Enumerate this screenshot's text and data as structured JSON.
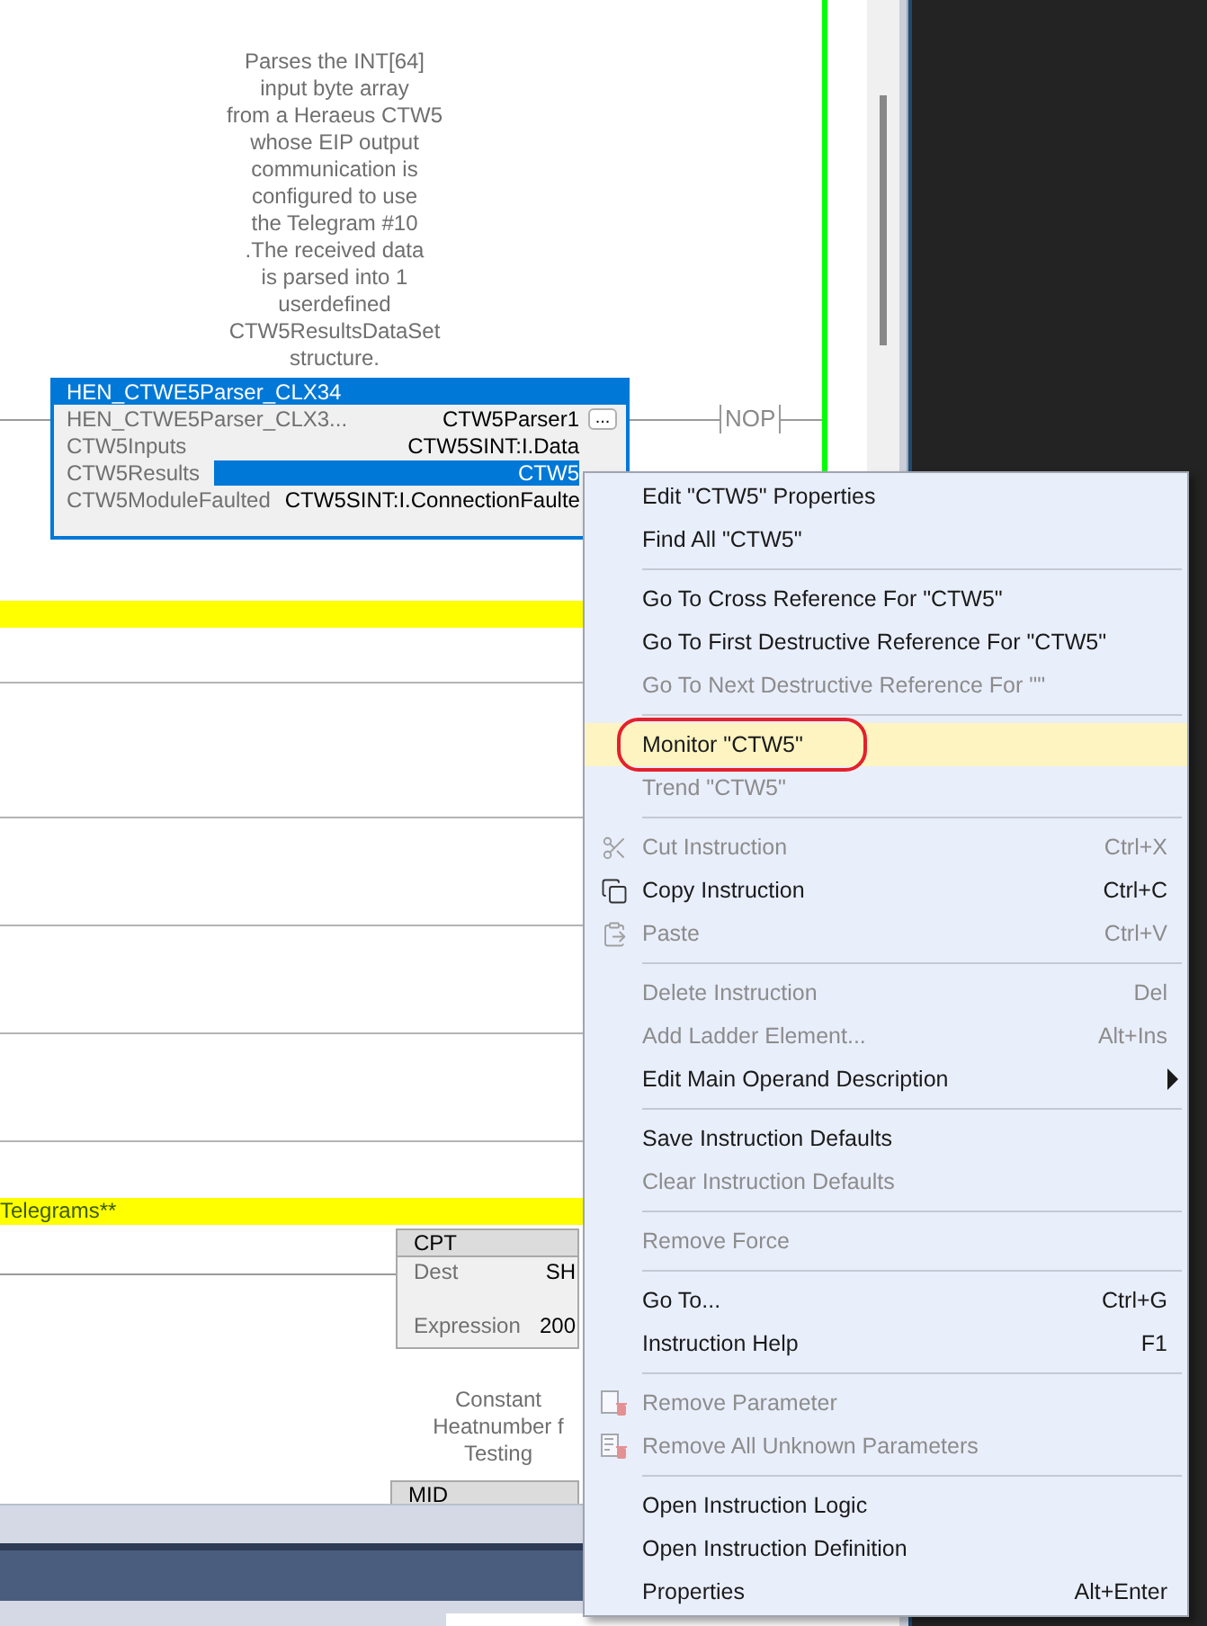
{
  "rung_description": {
    "lines": [
      "Parses the INT[64]",
      "input byte array",
      "from a Heraeus CTW5",
      "whose EIP output",
      "communication is",
      "configured to use",
      "the Telegram #10",
      ".The received data",
      "is parsed into 1",
      "userdefined",
      "CTW5ResultsDataSet",
      "structure."
    ]
  },
  "instruction_block": {
    "name": "HEN_CTWE5Parser_CLX34",
    "parameters": [
      {
        "name": "HEN_CTWE5Parser_CLX3...",
        "value": "CTW5Parser1",
        "selected": false,
        "browse_button": "..."
      },
      {
        "name": "CTW5Inputs",
        "value": "CTW5SINT:I.Data",
        "selected": false
      },
      {
        "name": "CTW5Results",
        "value": "CTW5",
        "selected": true
      },
      {
        "name": "CTW5ModuleFaulted",
        "value": "CTW5SINT:I.ConnectionFaulte",
        "selected": false
      }
    ]
  },
  "output_instruction": "NOP",
  "rung_comment": "Telegrams**",
  "cpt_block": {
    "name": "CPT",
    "parameters": [
      {
        "name": "Dest",
        "value": "SH"
      },
      {
        "name": "Expression",
        "value": "200"
      }
    ]
  },
  "mid_description": {
    "lines": [
      "Constant",
      "Heatnumber f",
      "Testing"
    ]
  },
  "mid_block": {
    "name": "MID"
  },
  "context_menu": {
    "items": [
      {
        "kind": "item",
        "label": "Edit \"CTW5\" Properties",
        "disabled": false,
        "selected": false
      },
      {
        "kind": "item",
        "label": "Find All \"CTW5\"",
        "disabled": false,
        "selected": false
      },
      {
        "kind": "separator"
      },
      {
        "kind": "item",
        "label": "Go To Cross Reference For \"CTW5\"",
        "disabled": false,
        "selected": false
      },
      {
        "kind": "item",
        "label": "Go To First Destructive Reference For \"CTW5\"",
        "disabled": false,
        "selected": false
      },
      {
        "kind": "item",
        "label": "Go To Next Destructive Reference For \"\"",
        "disabled": true,
        "selected": false
      },
      {
        "kind": "separator"
      },
      {
        "kind": "item",
        "label": "Monitor \"CTW5\"",
        "disabled": false,
        "selected": true,
        "circled": true
      },
      {
        "kind": "item",
        "label": "Trend \"CTW5\"",
        "disabled": true,
        "selected": false
      },
      {
        "kind": "separator"
      },
      {
        "kind": "cut",
        "label": "Cut Instruction",
        "shortcut": "Ctrl+X",
        "disabled": true,
        "selected": false
      },
      {
        "kind": "copy",
        "label": "Copy Instruction",
        "shortcut": "Ctrl+C",
        "disabled": false,
        "selected": false
      },
      {
        "kind": "paste",
        "label": "Paste",
        "shortcut": "Ctrl+V",
        "disabled": true,
        "selected": false
      },
      {
        "kind": "separator"
      },
      {
        "kind": "item",
        "label": "Delete Instruction",
        "shortcut": "Del",
        "disabled": true,
        "selected": false
      },
      {
        "kind": "item",
        "label": "Add Ladder Element...",
        "shortcut": "Alt+Ins",
        "disabled": true,
        "selected": false
      },
      {
        "kind": "item",
        "label": "Edit Main Operand Description",
        "disabled": false,
        "selected": false,
        "submenu": true
      },
      {
        "kind": "separator"
      },
      {
        "kind": "item",
        "label": "Save Instruction Defaults",
        "disabled": false,
        "selected": false
      },
      {
        "kind": "item",
        "label": "Clear Instruction Defaults",
        "disabled": true,
        "selected": false
      },
      {
        "kind": "separator"
      },
      {
        "kind": "item",
        "label": "Remove Force",
        "disabled": true,
        "selected": false
      },
      {
        "kind": "separator"
      },
      {
        "kind": "item",
        "label": "Go To...",
        "shortcut": "Ctrl+G",
        "disabled": false,
        "selected": false
      },
      {
        "kind": "item",
        "label": "Instruction Help",
        "shortcut": "F1",
        "disabled": false,
        "selected": false
      },
      {
        "kind": "separator"
      },
      {
        "kind": "remove-parameter",
        "label": "Remove Parameter",
        "disabled": true,
        "selected": false
      },
      {
        "kind": "remove-all-parameters",
        "label": "Remove All Unknown Parameters",
        "disabled": true,
        "selected": false
      },
      {
        "kind": "separator"
      },
      {
        "kind": "item",
        "label": "Open Instruction Logic",
        "disabled": false,
        "selected": false
      },
      {
        "kind": "item",
        "label": "Open Instruction Definition",
        "disabled": false,
        "selected": false
      },
      {
        "kind": "item",
        "label": "Properties",
        "shortcut": "Alt+Enter",
        "disabled": false,
        "selected": false
      }
    ]
  }
}
